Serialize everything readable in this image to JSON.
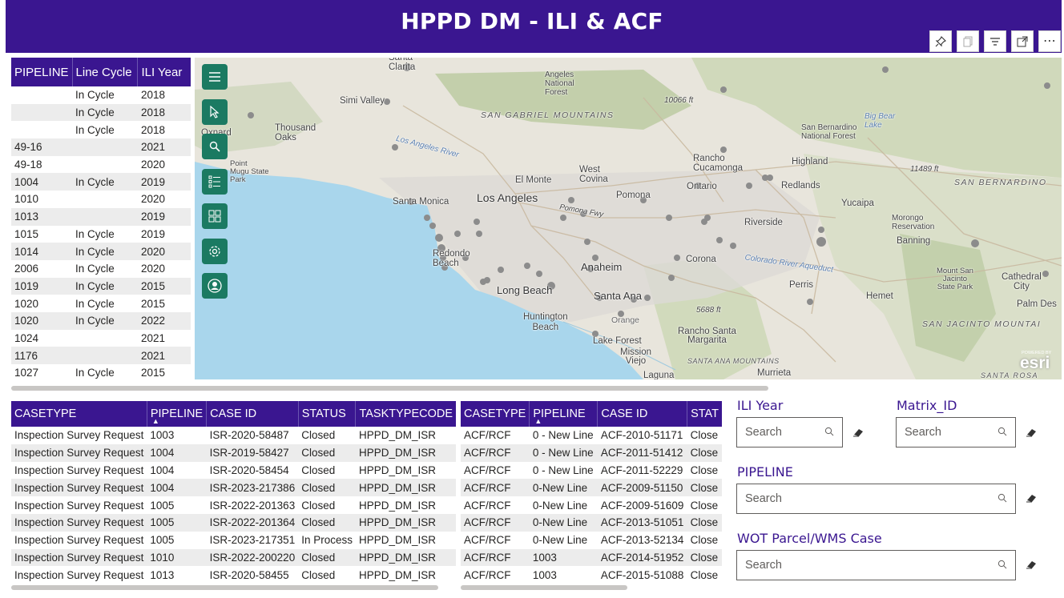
{
  "header": {
    "title": "HPPD DM - ILI & ACF",
    "color": "#3a1690"
  },
  "visual_actions": {
    "pin": "pin-icon",
    "copy": "copy-icon",
    "filter": "filter-icon",
    "focus": "focus-mode-icon",
    "more": "⋯"
  },
  "pipeline_table": {
    "columns": [
      "PIPELINE",
      "Line Cycle",
      "ILI Year"
    ],
    "rows": [
      [
        "",
        "In Cycle",
        "2018"
      ],
      [
        "",
        "In Cycle",
        "2018"
      ],
      [
        "",
        "In Cycle",
        "2018"
      ],
      [
        "49-16",
        "",
        "2021"
      ],
      [
        "49-18",
        "",
        "2020"
      ],
      [
        "1004",
        "In Cycle",
        "2019"
      ],
      [
        "1010",
        "",
        "2020"
      ],
      [
        "1013",
        "",
        "2019"
      ],
      [
        "1015",
        "In Cycle",
        "2019"
      ],
      [
        "1014",
        "In Cycle",
        "2020"
      ],
      [
        "2006",
        "In Cycle",
        "2020"
      ],
      [
        "1019",
        "In Cycle",
        "2015"
      ],
      [
        "1020",
        "In Cycle",
        "2015"
      ],
      [
        "1020",
        "In Cycle",
        "2022"
      ],
      [
        "1024",
        "",
        "2021"
      ],
      [
        "1176",
        "",
        "2021"
      ],
      [
        "1027",
        "In Cycle",
        "2015"
      ]
    ]
  },
  "map": {
    "tools": [
      "menu-icon",
      "select-icon",
      "search-icon",
      "legend-icon",
      "basemap-icon",
      "settings-icon",
      "user-icon"
    ],
    "labels": {
      "santa_clarita": "Santa\nClarita",
      "angeles_forest": "Angeles\nNational\nForest",
      "simi_valley": "Simi Valley",
      "san_gabriel_mtns": "SAN GABRIEL MOUNTAINS",
      "elev_10066": "10066 ft",
      "big_bear": "Big Bear\nLake",
      "sb_forest": "San Bernardino\nNational Forest",
      "oxnard": "Oxnard",
      "thousand_oaks": "Thousand\nOaks",
      "la_river": "Los Angeles River",
      "rancho_cuc": "Rancho\nCucamonga",
      "highland": "Highland",
      "elev_11489": "11489 ft",
      "san_bernardino": "SAN BERNARDINO",
      "point_mugu": "Point\nMugu State\nPark",
      "el_monte": "El Monte",
      "west_covina": "West\nCovina",
      "ontario": "Ontario",
      "redlands": "Redlands",
      "santa_monica": "Santa Monica",
      "los_angeles": "Los Angeles",
      "pomona": "Pomona",
      "pomona_fwy": "Pomona Fwy",
      "yucaipa": "Yucaipa",
      "morongo": "Morongo\nReservation",
      "riverside": "Riverside",
      "banning": "Banning",
      "redondo": "Redondo\nBeach",
      "anaheim": "Anaheim",
      "corona": "Corona",
      "colorado_aqueduct": "Colorado River Aqueduct",
      "mount_san_jacinto": "Mount San\nJacinto\nState Park",
      "cathedral": "Cathedral\nCity",
      "long_beach": "Long Beach",
      "santa_ana": "Santa Ana",
      "perris": "Perris",
      "hemet": "Hemet",
      "palm_desert": "Palm Des",
      "elev_5688": "5688 ft",
      "huntington": "Huntington\nBeach",
      "orange": "Orange",
      "san_jacinto_mtns": "SAN JACINTO MOUNTAI",
      "rancho_sm": "Rancho Santa\nMargarita",
      "lake_forest": "Lake Forest",
      "mission_viejo": "Mission\nViejo",
      "santa_ana_mtns": "SANTA ANA MOUNTAINS",
      "murrieta": "Murrieta",
      "laguna": "Laguna",
      "santa_rosa": "SANTA ROSA",
      "esri": "esri",
      "powered_by": "POWERED BY"
    }
  },
  "isr_table": {
    "columns": [
      "CASETYPE",
      "PIPELINE",
      "CASE ID",
      "STATUS",
      "TASKTYPECODE"
    ],
    "sort_indicator": "▲",
    "rows": [
      [
        "Inspection Survey Request",
        "1003",
        "ISR-2020-58487",
        "Closed",
        "HPPD_DM_ISR"
      ],
      [
        "Inspection Survey Request",
        "1004",
        "ISR-2019-58427",
        "Closed",
        "HPPD_DM_ISR"
      ],
      [
        "Inspection Survey Request",
        "1004",
        "ISR-2020-58454",
        "Closed",
        "HPPD_DM_ISR"
      ],
      [
        "Inspection Survey Request",
        "1004",
        "ISR-2023-217386",
        "Closed",
        "HPPD_DM_ISR"
      ],
      [
        "Inspection Survey Request",
        "1005",
        "ISR-2022-201363",
        "Closed",
        "HPPD_DM_ISR"
      ],
      [
        "Inspection Survey Request",
        "1005",
        "ISR-2022-201364",
        "Closed",
        "HPPD_DM_ISR"
      ],
      [
        "Inspection Survey Request",
        "1005",
        "ISR-2023-217351",
        "In Process",
        "HPPD_DM_ISR"
      ],
      [
        "Inspection Survey Request",
        "1010",
        "ISR-2022-200220",
        "Closed",
        "HPPD_DM_ISR"
      ],
      [
        "Inspection Survey Request",
        "1013",
        "ISR-2020-58455",
        "Closed",
        "HPPD_DM_ISR"
      ]
    ]
  },
  "acf_table": {
    "columns": [
      "CASETYPE",
      "PIPELINE",
      "CASE ID",
      "STAT"
    ],
    "sort_indicator": "▲",
    "rows": [
      [
        "ACF/RCF",
        "0 - New Line",
        "ACF-2010-51171",
        "Close"
      ],
      [
        "ACF/RCF",
        "0 - New Line",
        "ACF-2011-51412",
        "Close"
      ],
      [
        "ACF/RCF",
        "0 - New Line",
        "ACF-2011-52229",
        "Close"
      ],
      [
        "ACF/RCF",
        "0-New Line",
        "ACF-2009-51150",
        "Close"
      ],
      [
        "ACF/RCF",
        "0-New Line",
        "ACF-2009-51609",
        "Close"
      ],
      [
        "ACF/RCF",
        "0-New Line",
        "ACF-2013-51051",
        "Close"
      ],
      [
        "ACF/RCF",
        "0-New Line",
        "ACF-2013-52134",
        "Close"
      ],
      [
        "ACF/RCF",
        "1003",
        "ACF-2014-51952",
        "Close"
      ],
      [
        "ACF/RCF",
        "1003",
        "ACF-2015-51088",
        "Close"
      ]
    ]
  },
  "slicers": {
    "ili_year": {
      "label": "ILI Year",
      "placeholder": "Search"
    },
    "matrix_id": {
      "label": "Matrix_ID",
      "placeholder": "Search"
    },
    "pipeline": {
      "label": "PIPELINE",
      "placeholder": "Search"
    },
    "wot_parcel": {
      "label": "WOT Parcel/WMS Case",
      "placeholder": "Search"
    }
  }
}
